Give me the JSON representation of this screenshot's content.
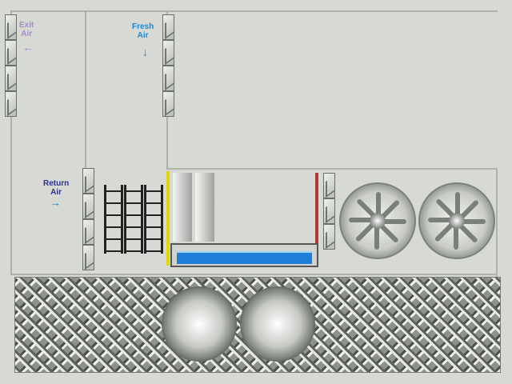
{
  "labels": {
    "exit_air": [
      "Exit",
      "Air"
    ],
    "fresh_air": [
      "Fresh",
      "Air"
    ],
    "return_air": [
      "Return",
      "Air"
    ]
  },
  "colors": {
    "exit": "#a98ac8",
    "fresh": "#1b86d2",
    "return": "#2c2e9a",
    "water": "#1f7ed8",
    "yellow_strip": "#e1d800",
    "red_strip": "#b6353b"
  },
  "icons": [
    "left-arrow-icon",
    "down-arrow-icon",
    "right-arrow-icon",
    "fan-icon",
    "cooling-coil-icon",
    "damper-icon"
  ]
}
